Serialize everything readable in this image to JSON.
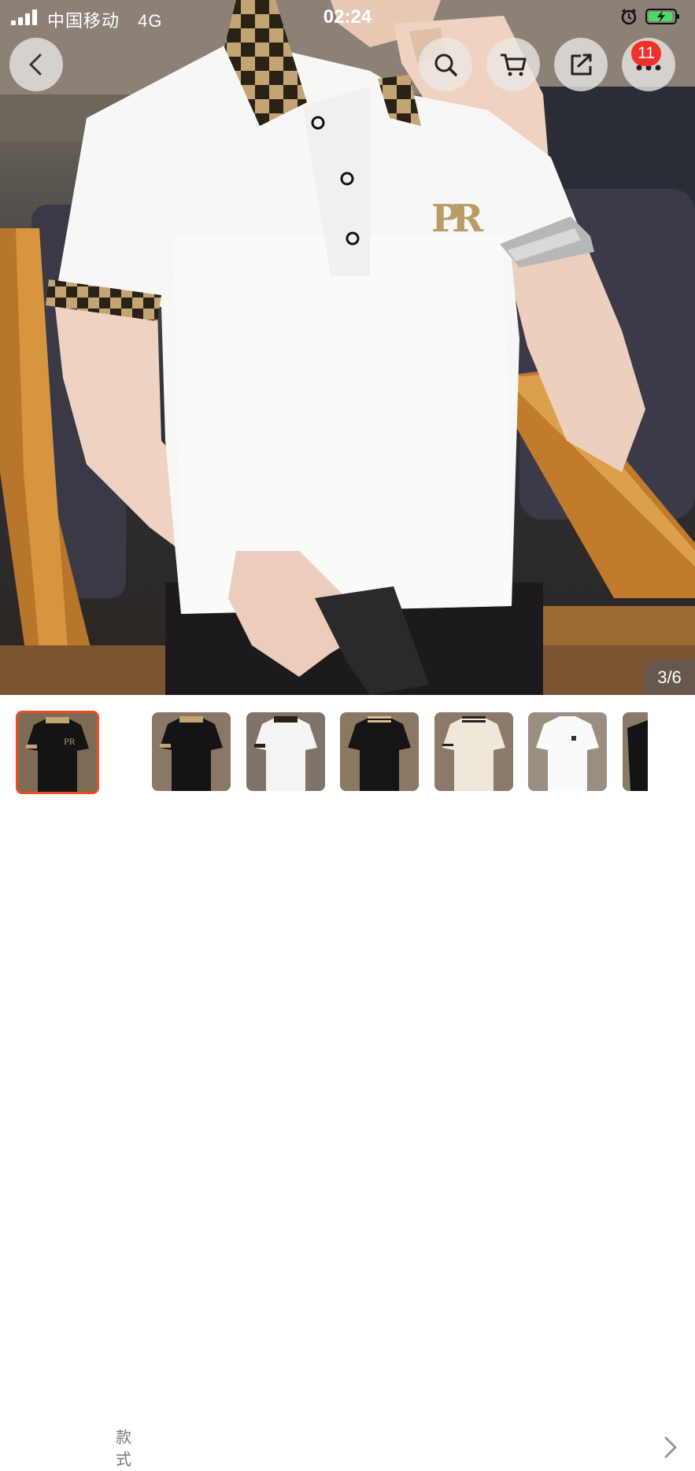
{
  "status_bar": {
    "carrier": "中国移动",
    "network": "4G",
    "time": "02:24"
  },
  "nav": {
    "back_icon": "chevron-left-icon",
    "search_icon": "search-icon",
    "cart_icon": "cart-icon",
    "share_icon": "share-icon",
    "more_icon": "more-icon",
    "notification_count": "11"
  },
  "product_image": {
    "page_indicator": "3/6",
    "logo_text": "PR"
  },
  "variants": {
    "style_label": "款式",
    "colors": {
      "accent_selected": "#ef4a23",
      "badge": "#f0312b"
    },
    "thumbnails": [
      {
        "shirt": "black",
        "collar": "checkered",
        "selected": true
      },
      {
        "shirt": "black",
        "collar": "checkered",
        "selected": false
      },
      {
        "shirt": "white",
        "collar": "checkered",
        "selected": false
      },
      {
        "shirt": "black",
        "collar": "striped",
        "selected": false
      },
      {
        "shirt": "cream",
        "collar": "striped",
        "selected": false
      },
      {
        "shirt": "white",
        "collar": "plain",
        "selected": false
      },
      {
        "shirt": "black",
        "collar": "plain",
        "selected": false
      }
    ]
  }
}
